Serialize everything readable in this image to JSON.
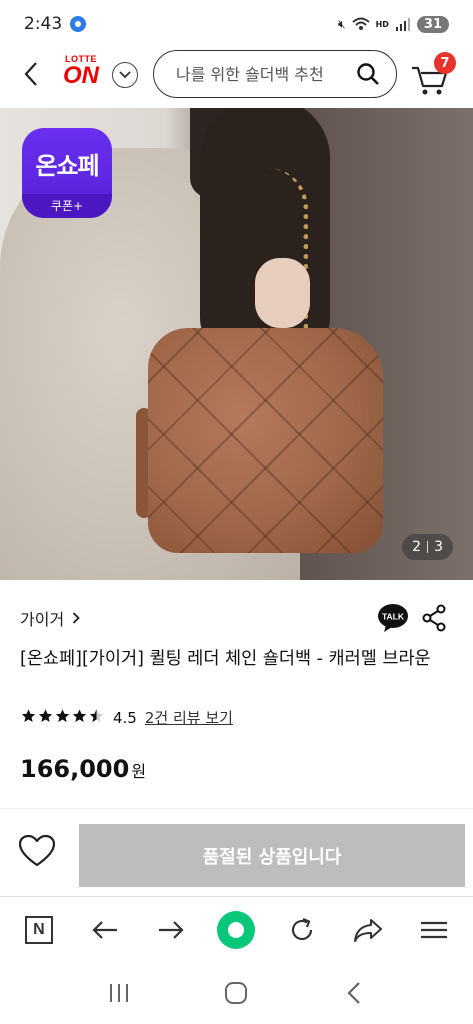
{
  "status_bar": {
    "time": "2:43",
    "battery": "31"
  },
  "header": {
    "logo_top": "LOTTE",
    "logo_main": "ON",
    "search_placeholder": "나를 위한 숄더백 추천",
    "cart_count": "7"
  },
  "hero": {
    "coupon_title": "온쇼페",
    "coupon_sub": "쿠폰+",
    "page_current": "2",
    "page_total": "3"
  },
  "product": {
    "brand": "가이거",
    "title": "[온쇼페][가이거] 퀼팅 레더 체인 숄더백 - 캐러멜 브라운",
    "rating_score": "4.5",
    "rating_value": 4.5,
    "reviews_link": "2건 리뷰 보기",
    "price": "166,000",
    "currency": "원"
  },
  "actions": {
    "soldout_label": "품절된 상품입니다",
    "talk_label": "TALK"
  }
}
